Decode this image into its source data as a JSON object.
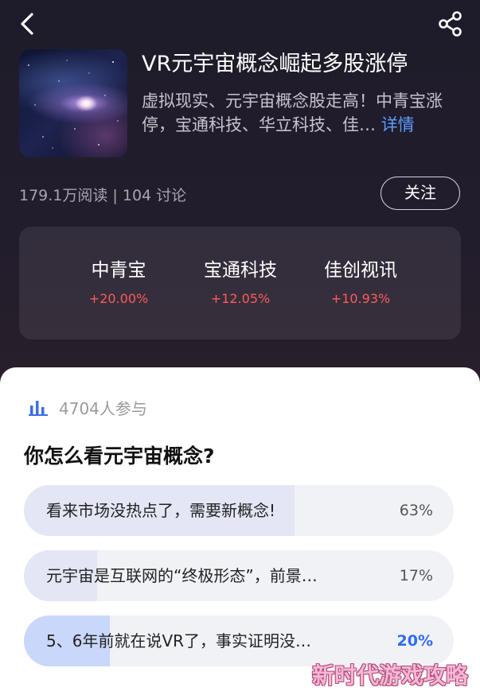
{
  "header": {
    "back_icon": "chevron-left-icon",
    "share_icon": "share-icon"
  },
  "topic": {
    "title": "VR元宇宙概念崛起多股涨停",
    "description": "虚拟现实、元宇宙概念股走高！中青宝涨停，宝通科技、华立科技、佳…",
    "more_label": "详情",
    "stats": "179.1万阅读 | 104 讨论",
    "follow_label": "关注"
  },
  "stocks": [
    {
      "name": "中青宝",
      "change": "+20.00%"
    },
    {
      "name": "宝通科技",
      "change": "+12.05%"
    },
    {
      "name": "佳创视讯",
      "change": "+10.93%"
    }
  ],
  "colors": {
    "up": "#ff5a5a",
    "accent": "#2f6bf5",
    "link": "#5d9bff"
  },
  "poll": {
    "participants": "4704人参与",
    "question": "你怎么看元宇宙概念?",
    "options": [
      {
        "text": "看来市场没热点了，需要新概念!",
        "percent": "63%",
        "value": 63,
        "selected": false
      },
      {
        "text": "元宇宙是互联网的“终极形态”，前景…",
        "percent": "17%",
        "value": 17,
        "selected": false
      },
      {
        "text": "5、6年前就在说VR了，事实证明没…",
        "percent": "20%",
        "value": 20,
        "selected": true
      }
    ]
  },
  "watermark": "新时代游戏攻略"
}
